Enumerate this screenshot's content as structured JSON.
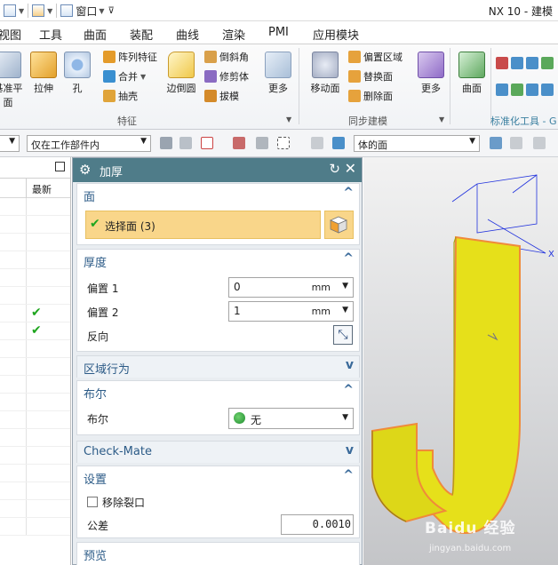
{
  "titlebar": {
    "window_menu": "窗口",
    "app_title": "NX 10 - 建模"
  },
  "menubar": {
    "items": [
      "视图",
      "工具",
      "曲面",
      "装配",
      "曲线",
      "渲染",
      "PMI",
      "应用模块"
    ]
  },
  "ribbon": {
    "big_buttons": [
      {
        "label": "基准平面",
        "icon": "datum-plane-icon"
      },
      {
        "label": "拉伸",
        "icon": "extrude-icon"
      },
      {
        "label": "孔",
        "icon": "hole-icon"
      },
      {
        "label": "边倒圆",
        "icon": "edge-blend-icon"
      },
      {
        "label": "更多",
        "icon": "more-icon"
      },
      {
        "label": "移动面",
        "icon": "move-face-icon"
      },
      {
        "label": "更多",
        "icon": "more-icon"
      },
      {
        "label": "曲面",
        "icon": "surface-icon"
      }
    ],
    "small_buttons": [
      {
        "label": "阵列特征",
        "icon": "pattern-feature-icon"
      },
      {
        "label": "合并",
        "icon": "unite-icon"
      },
      {
        "label": "抽壳",
        "icon": "shell-icon"
      },
      {
        "label": "倒斜角",
        "icon": "chamfer-icon"
      },
      {
        "label": "修剪体",
        "icon": "trim-body-icon"
      },
      {
        "label": "拔模",
        "icon": "draft-icon"
      },
      {
        "label": "偏置区域",
        "icon": "offset-region-icon"
      },
      {
        "label": "替换面",
        "icon": "replace-face-icon"
      },
      {
        "label": "删除面",
        "icon": "delete-face-icon"
      }
    ],
    "groups": [
      "特征",
      "同步建模",
      "标准化工具 - G"
    ]
  },
  "selection_bar": {
    "scope": "仅在工作部件内",
    "filter": "体的面"
  },
  "navigator": {
    "column_latest": "最新",
    "checked_rows": [
      7,
      8
    ]
  },
  "dialog": {
    "title": "加厚",
    "sections": {
      "face": {
        "title": "面",
        "select_label": "选择面 (3)"
      },
      "thickness": {
        "title": "厚度",
        "offset1_label": "偏置 1",
        "offset1_value": "0",
        "offset1_unit": "mm",
        "offset2_label": "偏置 2",
        "offset2_value": "1",
        "offset2_unit": "mm",
        "reverse_label": "反向"
      },
      "region": {
        "title": "区域行为"
      },
      "boolean": {
        "title": "布尔",
        "label": "布尔",
        "value": "无"
      },
      "checkmate": {
        "title": "Check-Mate"
      },
      "settings": {
        "title": "设置",
        "remove_gap_label": "移除裂口",
        "tolerance_label": "公差",
        "tolerance_value": "0.0010"
      },
      "preview": {
        "title": "预览"
      }
    }
  },
  "viewport": {
    "axis_label": "X",
    "watermark": "Baidu 经验",
    "watermark_url": "jingyan.baidu.com"
  },
  "colors": {
    "dialog_title_bg": "#4f7c89",
    "selection_highlight": "#f9d68a",
    "part_yellow": "#e6e01a",
    "part_edge": "#f08a3a",
    "check_green": "#1ea51e",
    "section_title": "#2c5b87"
  }
}
